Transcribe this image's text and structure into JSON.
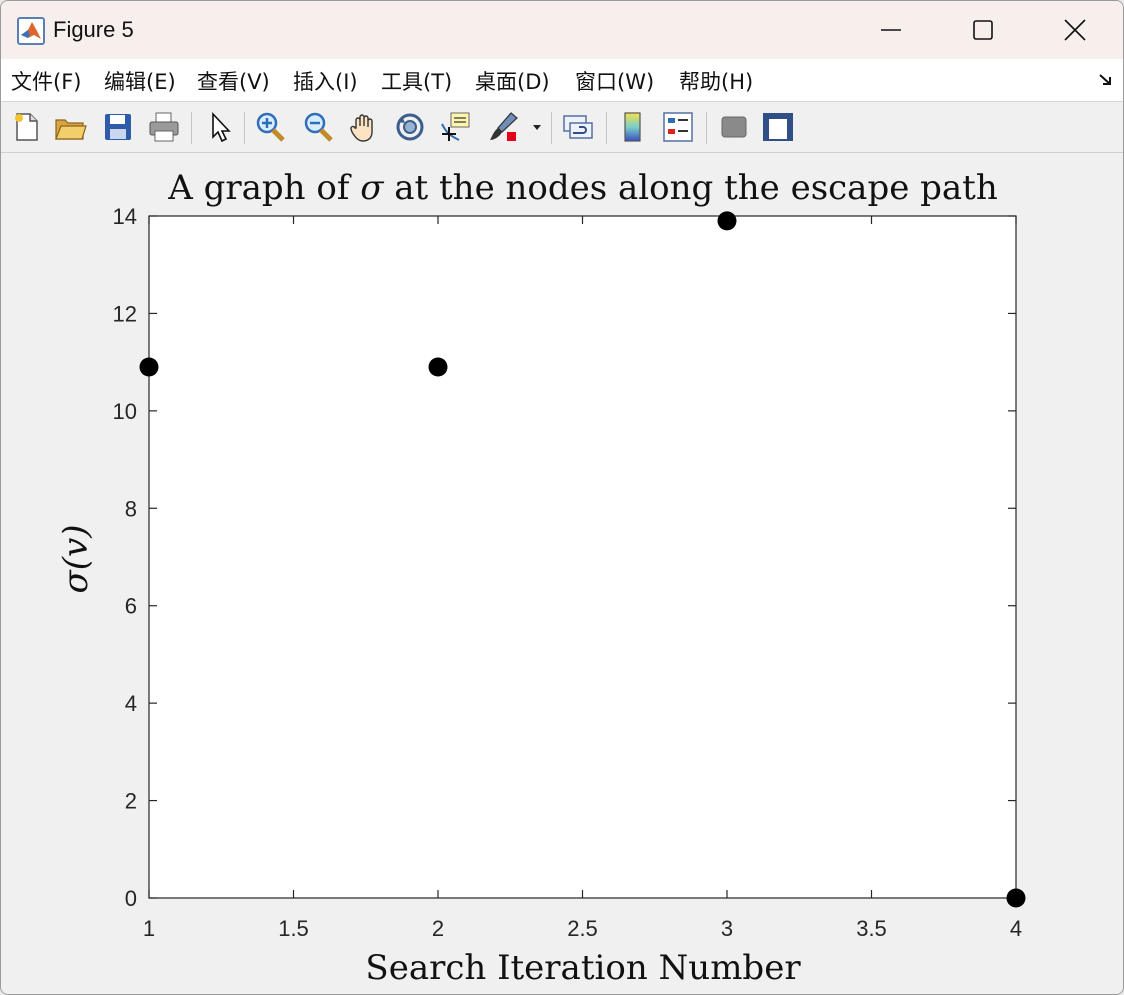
{
  "window": {
    "title": "Figure 5",
    "controls": [
      "minimize",
      "maximize",
      "close"
    ]
  },
  "menu": {
    "items": [
      "文件(F)",
      "编辑(E)",
      "查看(V)",
      "插入(I)",
      "工具(T)",
      "桌面(D)",
      "窗口(W)",
      "帮助(H)"
    ]
  },
  "toolbar": {
    "icons": [
      "new-figure-icon",
      "open-file-icon",
      "save-icon",
      "print-icon",
      "pointer-icon",
      "zoom-in-icon",
      "zoom-out-icon",
      "pan-icon",
      "rotate-3d-icon",
      "data-cursor-icon",
      "brush-icon",
      "link-plot-icon",
      "colorbar-icon",
      "legend-icon",
      "hide-plot-tools-icon",
      "show-plot-tools-icon"
    ]
  },
  "chart_data": {
    "type": "scatter",
    "title_prefix": "A graph of ",
    "title_symbol": "σ",
    "title_suffix": " at the nodes along the escape path",
    "xlabel": "Search Iteration Number",
    "ylabel": "σ(v)",
    "x": [
      1,
      2,
      3,
      4
    ],
    "y": [
      10.9,
      10.9,
      13.9,
      0
    ],
    "xlim": [
      1,
      4
    ],
    "ylim": [
      0,
      14
    ],
    "xticks": [
      "1",
      "1.5",
      "2",
      "2.5",
      "3",
      "3.5",
      "4"
    ],
    "yticks": [
      "0",
      "2",
      "4",
      "6",
      "8",
      "10",
      "12",
      "14"
    ],
    "marker_color": "#000000",
    "grid": false,
    "legend": "none"
  }
}
